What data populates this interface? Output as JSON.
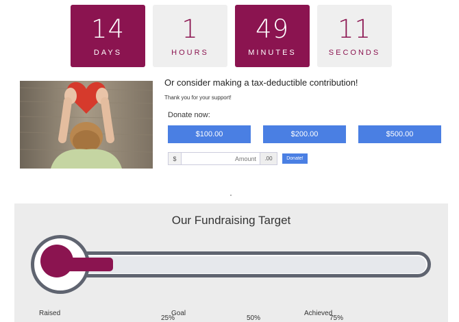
{
  "countdown": [
    {
      "value": "14",
      "label": "DAYS",
      "style": "dark"
    },
    {
      "value": "1",
      "label": "HOURS",
      "style": "light"
    },
    {
      "value": "49",
      "label": "MINUTES",
      "style": "dark"
    },
    {
      "value": "11",
      "label": "SECONDS",
      "style": "light"
    }
  ],
  "donate": {
    "title": "Or consider making a tax-deductible contribution!",
    "thanks": "Thank you for your support!",
    "donate_now": "Donate now:",
    "amounts": [
      "$100.00",
      "$200.00",
      "$500.00"
    ],
    "currency_symbol": "$",
    "amount_placeholder": "Amount",
    "cents_suffix": ".00",
    "submit_label": "Donate!"
  },
  "target": {
    "title": "Our Fundraising Target",
    "ticks": [
      "25%",
      "50%",
      "75%"
    ],
    "progress_fraction": 0.2,
    "stats": [
      "Raised",
      "Goal",
      "Achieved"
    ]
  },
  "colors": {
    "accent": "#8b1450",
    "button_blue": "#4a7fe3",
    "tube_border": "#5f6470"
  }
}
